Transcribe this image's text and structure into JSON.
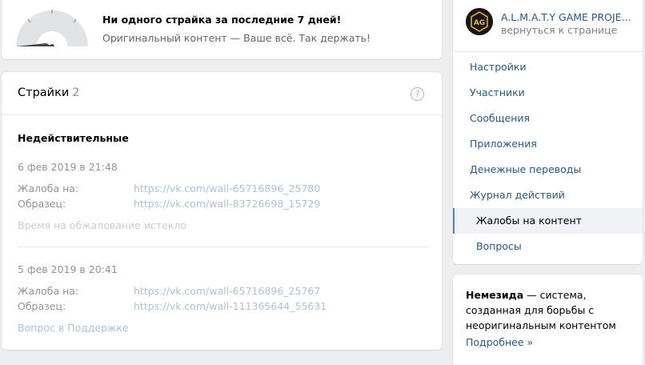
{
  "status": {
    "title": "Ни одного страйка за последние 7 дней!",
    "subtitle": "Оригинальный контент — Ваше всё. Так держать!"
  },
  "strikes": {
    "title": "Страйки",
    "count": "2",
    "help_icon": "?",
    "section_label": "Недействительные",
    "items": [
      {
        "date": "6 фев 2019 в 21:48",
        "complaint_label": "Жалоба на:",
        "complaint_link": "https://vk.com/wall-65716896_25780",
        "sample_label": "Образец:",
        "sample_link": "https://vk.com/wall-83726698_15729",
        "note": "Время на обжалование истекло"
      },
      {
        "date": "5 фев 2019 в 20:41",
        "complaint_label": "Жалоба на:",
        "complaint_link": "https://vk.com/wall-65716896_25767",
        "sample_label": "Образец:",
        "sample_link": "https://vk.com/wall-111365644_55631",
        "note": "Вопрос в Поддержке"
      }
    ]
  },
  "group": {
    "name": "A.L.M.A.T.Y GAME PROJE...",
    "back": "вернуться к странице",
    "avatar_text": "AG"
  },
  "nav": {
    "items": [
      {
        "label": "Настройки"
      },
      {
        "label": "Участники"
      },
      {
        "label": "Сообщения"
      },
      {
        "label": "Приложения"
      },
      {
        "label": "Денежные переводы"
      },
      {
        "label": "Журнал действий"
      },
      {
        "label": "Жалобы на контент",
        "active": true
      },
      {
        "label": "Вопросы"
      }
    ]
  },
  "info": {
    "bold": "Немезида",
    "text": " — система, созданная для борьбы с неоригинальным контентом",
    "more": "Подробнее »"
  },
  "colors": {
    "link": "#2a5885",
    "active_border": "#5181b8",
    "background": "#edeef0"
  }
}
